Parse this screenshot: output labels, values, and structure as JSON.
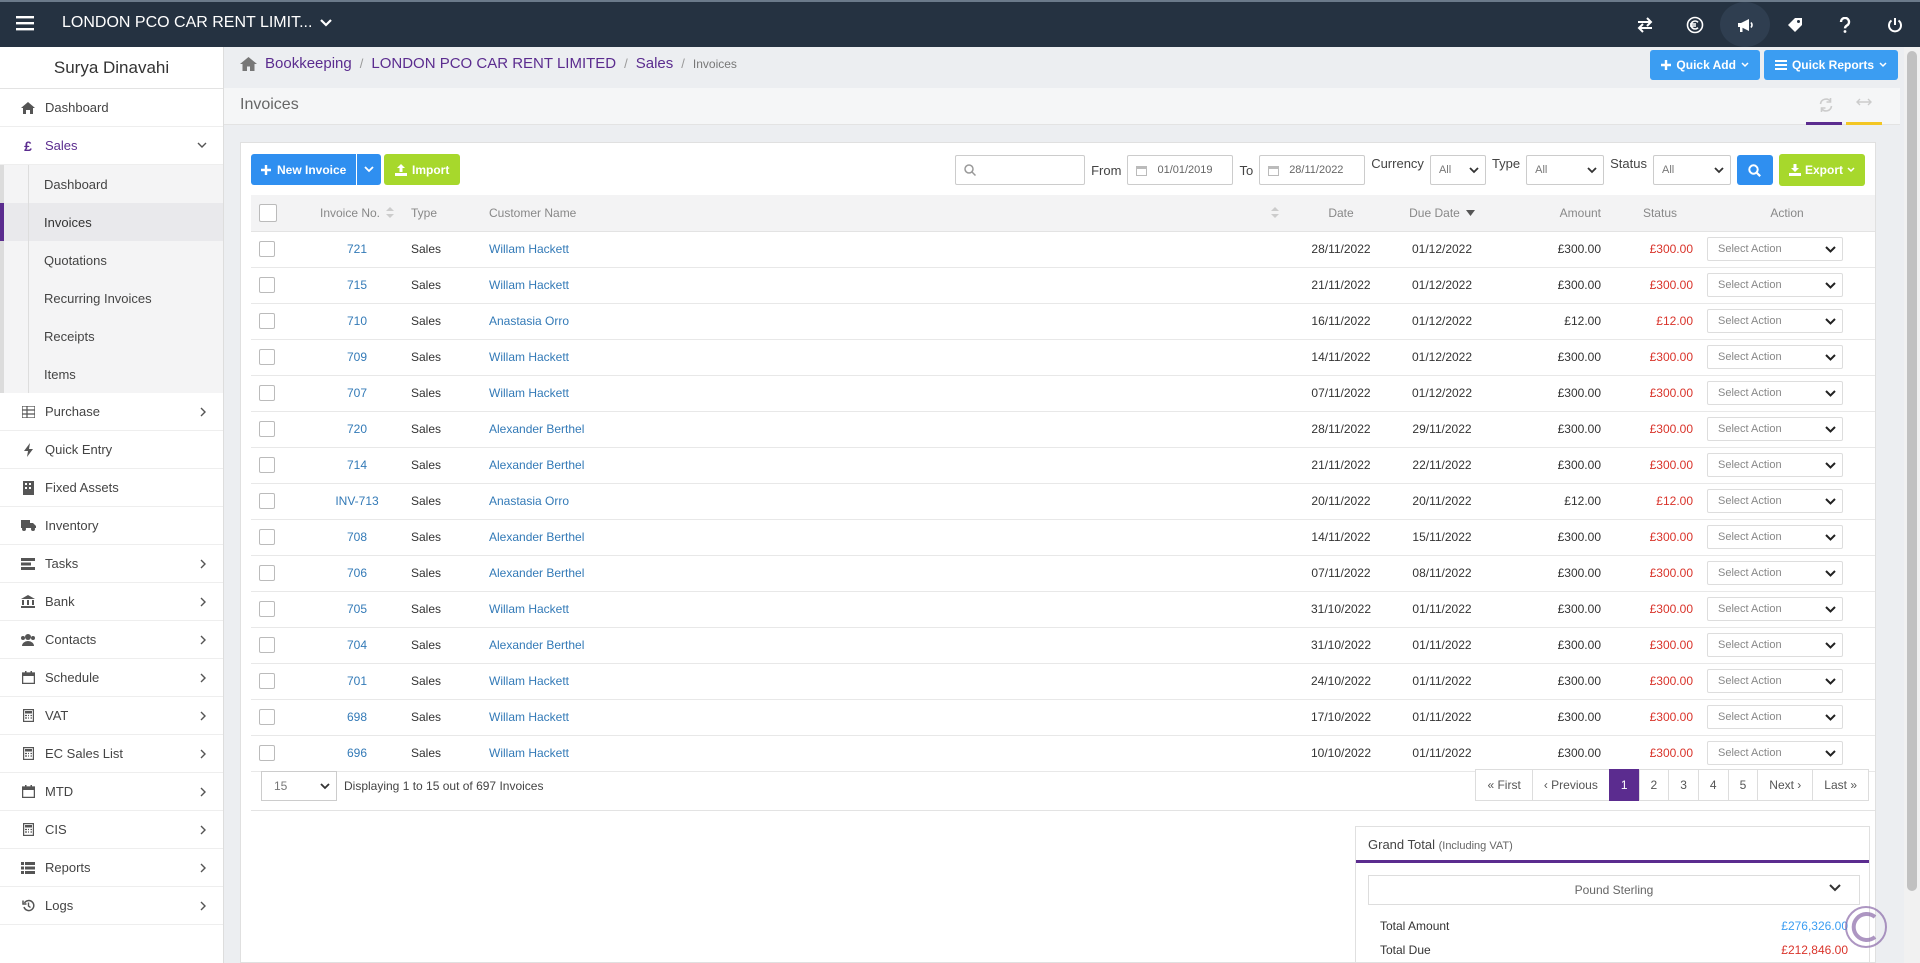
{
  "topbar": {
    "company": "LONDON PCO CAR RENT LIMIT...",
    "icons": [
      "switch-icon",
      "currency-icon",
      "announcement-icon",
      "tag-icon",
      "help-icon",
      "power-icon"
    ]
  },
  "sidebar": {
    "user": "Surya Dinavahi",
    "items": [
      {
        "label": "Dashboard",
        "icon": "home-icon"
      },
      {
        "label": "Sales",
        "icon": "pound-icon"
      },
      {
        "label": "Purchase",
        "icon": "purchase-icon"
      },
      {
        "label": "Quick Entry",
        "icon": "bolt-icon"
      },
      {
        "label": "Fixed Assets",
        "icon": "building-icon"
      },
      {
        "label": "Inventory",
        "icon": "truck-icon"
      },
      {
        "label": "Tasks",
        "icon": "tasks-icon"
      },
      {
        "label": "Bank",
        "icon": "bank-icon"
      },
      {
        "label": "Contacts",
        "icon": "users-icon"
      },
      {
        "label": "Schedule",
        "icon": "calendar-icon"
      },
      {
        "label": "VAT",
        "icon": "calculator-icon"
      },
      {
        "label": "EC Sales List",
        "icon": "calculator-icon"
      },
      {
        "label": "MTD",
        "icon": "calendar-icon"
      },
      {
        "label": "CIS",
        "icon": "calculator-icon"
      },
      {
        "label": "Reports",
        "icon": "list-icon"
      },
      {
        "label": "Logs",
        "icon": "history-icon"
      }
    ],
    "sales_sub": [
      "Dashboard",
      "Invoices",
      "Quotations",
      "Recurring Invoices",
      "Receipts",
      "Items"
    ]
  },
  "breadcrumb": {
    "items": [
      "Bookkeeping",
      "LONDON PCO CAR RENT LIMITED",
      "Sales"
    ],
    "current": "Invoices"
  },
  "header": {
    "quick_add": "Quick Add",
    "quick_reports": "Quick Reports",
    "title": "Invoices"
  },
  "toolbar": {
    "new_invoice": "New Invoice",
    "import": "Import",
    "search_placeholder": "",
    "from_label": "From",
    "from_value": "01/01/2019",
    "to_label": "To",
    "to_value": "28/11/2022",
    "currency_label": "Currency",
    "currency_value": "All",
    "type_label": "Type",
    "type_value": "All",
    "status_label": "Status",
    "status_value": "All",
    "export": "Export"
  },
  "table": {
    "headers": {
      "invoice_no": "Invoice No.",
      "type": "Type",
      "customer": "Customer Name",
      "date": "Date",
      "due_date": "Due Date",
      "amount": "Amount",
      "status": "Status",
      "action": "Action"
    },
    "action_placeholder": "Select Action",
    "rows": [
      {
        "no": "721",
        "type": "Sales",
        "customer": "Willam Hackett",
        "date": "28/11/2022",
        "due": "01/12/2022",
        "amount": "£300.00",
        "status": "£300.00"
      },
      {
        "no": "715",
        "type": "Sales",
        "customer": "Willam Hackett",
        "date": "21/11/2022",
        "due": "01/12/2022",
        "amount": "£300.00",
        "status": "£300.00"
      },
      {
        "no": "710",
        "type": "Sales",
        "customer": "Anastasia Orro",
        "date": "16/11/2022",
        "due": "01/12/2022",
        "amount": "£12.00",
        "status": "£12.00"
      },
      {
        "no": "709",
        "type": "Sales",
        "customer": "Willam Hackett",
        "date": "14/11/2022",
        "due": "01/12/2022",
        "amount": "£300.00",
        "status": "£300.00"
      },
      {
        "no": "707",
        "type": "Sales",
        "customer": "Willam Hackett",
        "date": "07/11/2022",
        "due": "01/12/2022",
        "amount": "£300.00",
        "status": "£300.00"
      },
      {
        "no": "720",
        "type": "Sales",
        "customer": "Alexander Berthel",
        "date": "28/11/2022",
        "due": "29/11/2022",
        "amount": "£300.00",
        "status": "£300.00"
      },
      {
        "no": "714",
        "type": "Sales",
        "customer": "Alexander Berthel",
        "date": "21/11/2022",
        "due": "22/11/2022",
        "amount": "£300.00",
        "status": "£300.00"
      },
      {
        "no": "INV-713",
        "type": "Sales",
        "customer": "Anastasia Orro",
        "date": "20/11/2022",
        "due": "20/11/2022",
        "amount": "£12.00",
        "status": "£12.00"
      },
      {
        "no": "708",
        "type": "Sales",
        "customer": "Alexander Berthel",
        "date": "14/11/2022",
        "due": "15/11/2022",
        "amount": "£300.00",
        "status": "£300.00"
      },
      {
        "no": "706",
        "type": "Sales",
        "customer": "Alexander Berthel",
        "date": "07/11/2022",
        "due": "08/11/2022",
        "amount": "£300.00",
        "status": "£300.00"
      },
      {
        "no": "705",
        "type": "Sales",
        "customer": "Willam Hackett",
        "date": "31/10/2022",
        "due": "01/11/2022",
        "amount": "£300.00",
        "status": "£300.00"
      },
      {
        "no": "704",
        "type": "Sales",
        "customer": "Alexander Berthel",
        "date": "31/10/2022",
        "due": "01/11/2022",
        "amount": "£300.00",
        "status": "£300.00"
      },
      {
        "no": "701",
        "type": "Sales",
        "customer": "Willam Hackett",
        "date": "24/10/2022",
        "due": "01/11/2022",
        "amount": "£300.00",
        "status": "£300.00"
      },
      {
        "no": "698",
        "type": "Sales",
        "customer": "Willam Hackett",
        "date": "17/10/2022",
        "due": "01/11/2022",
        "amount": "£300.00",
        "status": "£300.00"
      },
      {
        "no": "696",
        "type": "Sales",
        "customer": "Willam Hackett",
        "date": "10/10/2022",
        "due": "01/11/2022",
        "amount": "£300.00",
        "status": "£300.00"
      }
    ]
  },
  "pagination": {
    "page_size": "15",
    "display": "Displaying 1 to 15 out of 697 Invoices",
    "first": "« First",
    "previous": "‹ Previous",
    "pages": [
      "1",
      "2",
      "3",
      "4",
      "5"
    ],
    "active_page": "1",
    "next": "Next ›",
    "last": "Last »"
  },
  "grand_total": {
    "title": "Grand Total",
    "subtitle": "(Including VAT)",
    "currency": "Pound Sterling",
    "total_amount_label": "Total Amount",
    "total_amount": "£276,326.00",
    "total_due_label": "Total Due",
    "total_due": "£212,846.00"
  },
  "colors": {
    "brand_purple": "#5b2c8f",
    "topbar": "#253241",
    "primary_blue": "#2f8ff0",
    "green": "#a7d82c",
    "danger_red": "#d9342b"
  }
}
